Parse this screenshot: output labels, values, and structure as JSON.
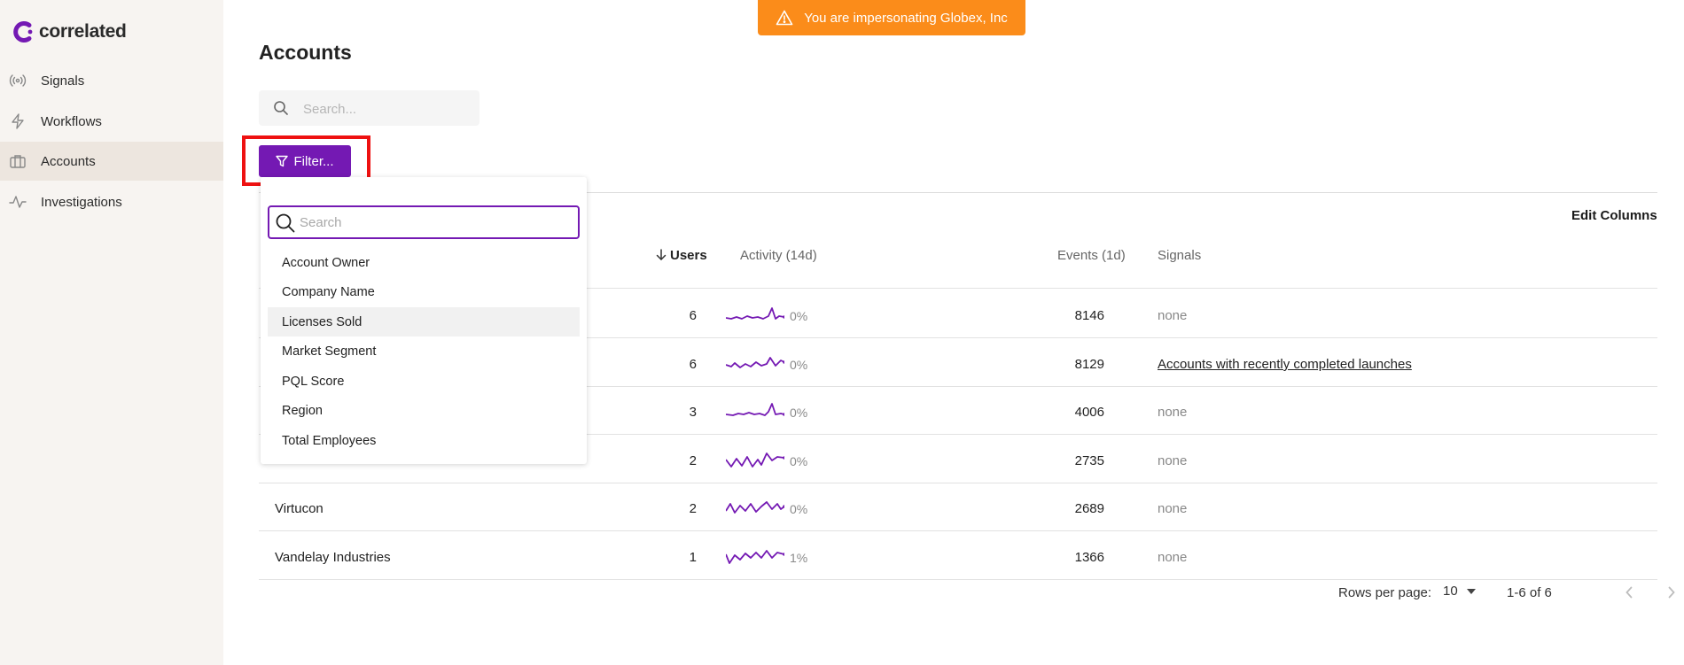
{
  "brand": {
    "name": "correlated",
    "color": "#7419b3"
  },
  "banner": {
    "text": "You are impersonating Globex, Inc",
    "icon": "warning-icon",
    "color": "#fb8c1a"
  },
  "sidebar": {
    "items": [
      {
        "label": "Signals",
        "icon": "signal-icon"
      },
      {
        "label": "Workflows",
        "icon": "bolt-icon"
      },
      {
        "label": "Accounts",
        "icon": "briefcase-icon",
        "active": true
      },
      {
        "label": "Investigations",
        "icon": "pulse-icon"
      }
    ]
  },
  "page": {
    "title": "Accounts"
  },
  "search": {
    "placeholder": "Search..."
  },
  "filter": {
    "label": "Filter..."
  },
  "edit_columns": "Edit Columns",
  "dropdown": {
    "search_placeholder": "Search",
    "options": [
      "Account Owner",
      "Company Name",
      "Licenses Sold",
      "Market Segment",
      "PQL Score",
      "Region",
      "Total Employees"
    ],
    "hovered": "Licenses Sold"
  },
  "table": {
    "headers": {
      "users": "Users",
      "activity": "Activity (14d)",
      "events": "Events (1d)",
      "signals": "Signals"
    },
    "rows": [
      {
        "name": "",
        "users": "6",
        "activity": "0%",
        "events": "8146",
        "signals": "none"
      },
      {
        "name": "",
        "users": "6",
        "activity": "0%",
        "events": "8129",
        "signals": "Accounts with recently completed launches"
      },
      {
        "name": "",
        "users": "3",
        "activity": "0%",
        "events": "4006",
        "signals": "none"
      },
      {
        "name": "",
        "users": "2",
        "activity": "0%",
        "events": "2735",
        "signals": "none"
      },
      {
        "name": "Virtucon",
        "users": "2",
        "activity": "0%",
        "events": "2689",
        "signals": "none"
      },
      {
        "name": "Vandelay Industries",
        "users": "1",
        "activity": "1%",
        "events": "1366",
        "signals": "none"
      }
    ]
  },
  "pagination": {
    "rows_per_page_label": "Rows per page:",
    "rows_per_page": "10",
    "range": "1-6 of 6"
  }
}
